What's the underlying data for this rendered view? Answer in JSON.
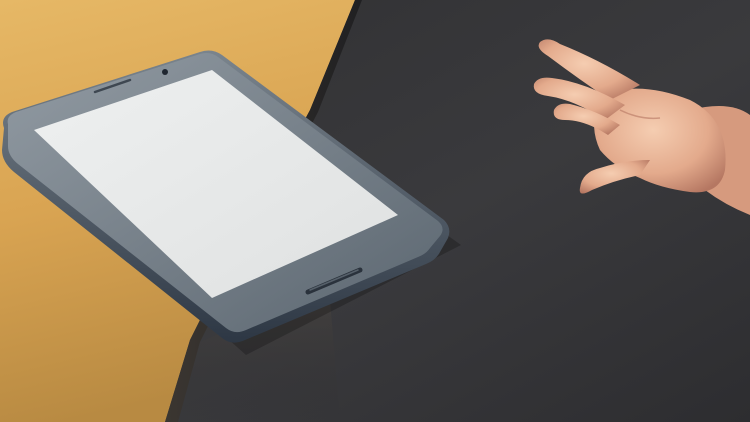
{
  "scene": {
    "colors": {
      "tabletop_light": "#e2b25f",
      "tabletop_mid": "#d5a04c",
      "tabletop_dark": "#b7863d",
      "background_dark": "#2b2b2d",
      "background_mid": "#3a3a3d",
      "tablet_body": "#3c4552",
      "tablet_bezel": "#6f7a84",
      "tablet_bezel_light": "#8b949c",
      "screen": "#e8e9e9",
      "skin_light": "#f2c3a5",
      "skin_mid": "#d9a084",
      "skin_shadow": "#a86b54"
    },
    "icons": {
      "camera": "tablet-front-camera-icon",
      "home_button": "tablet-home-button"
    }
  }
}
